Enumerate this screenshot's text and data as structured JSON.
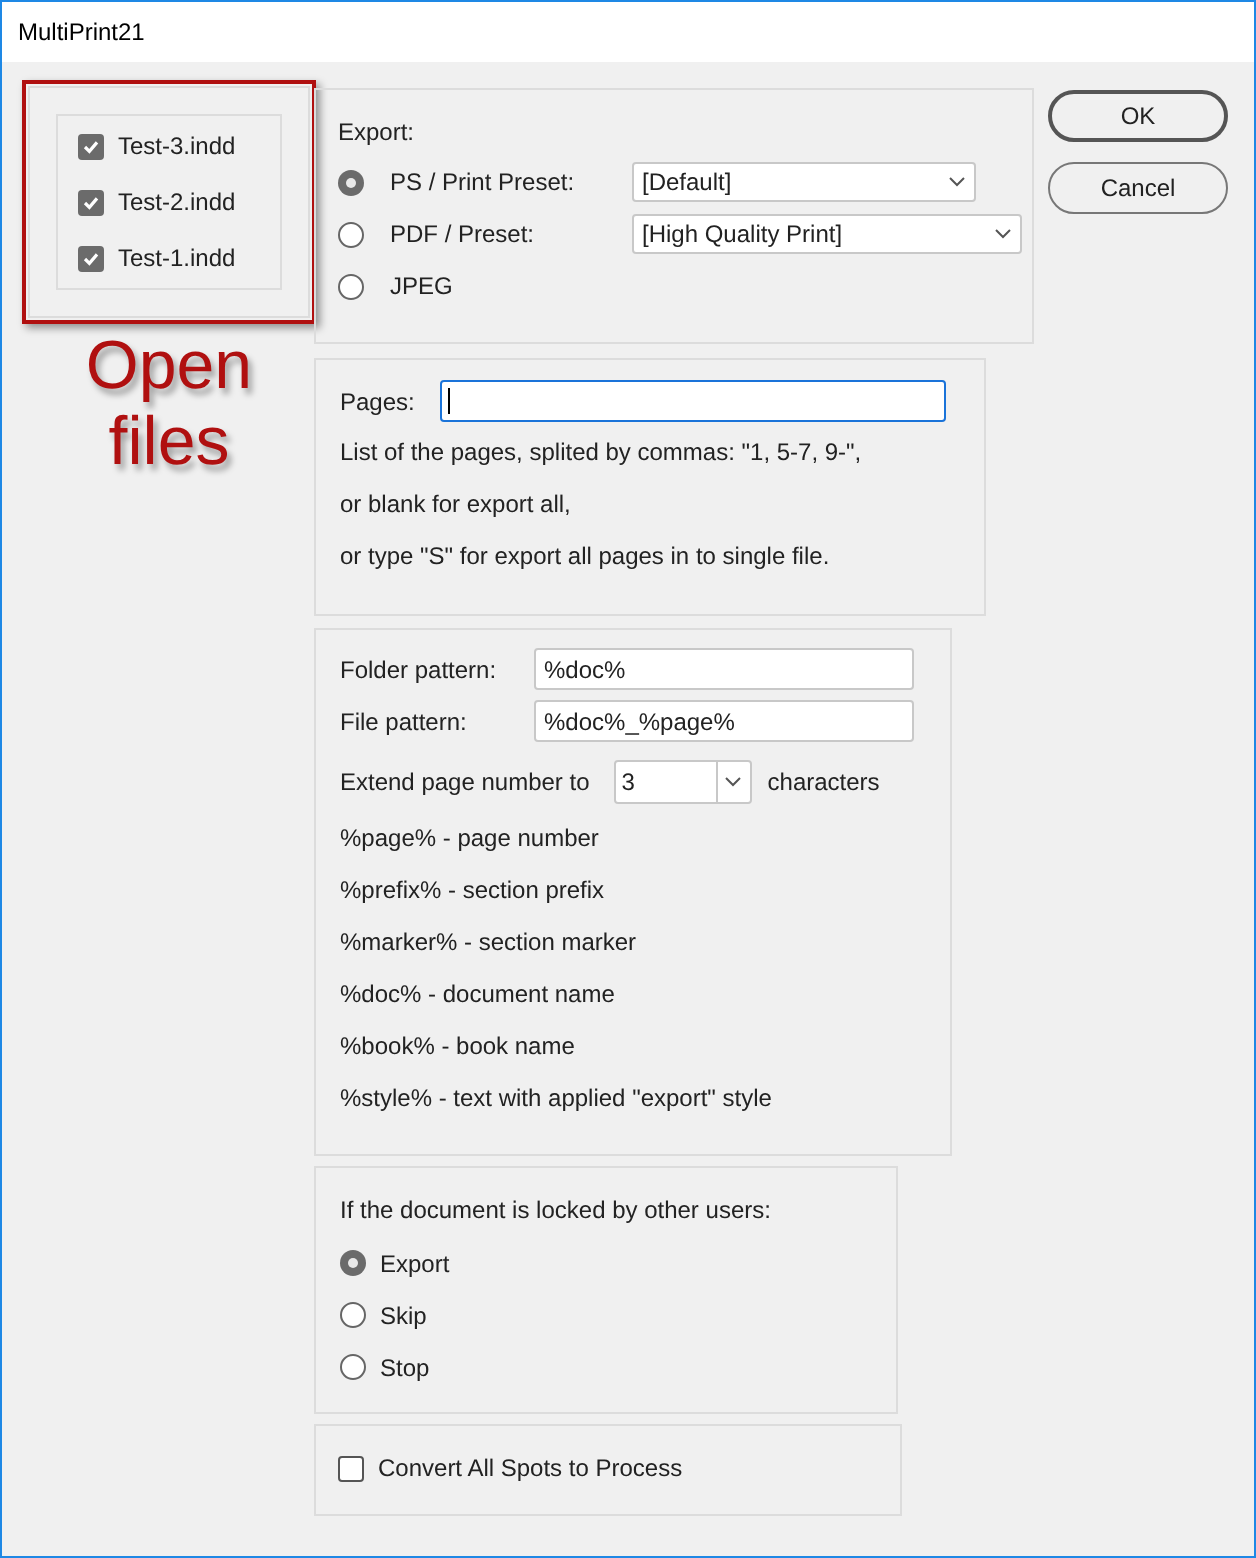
{
  "window": {
    "title": "MultiPrint21"
  },
  "files": [
    {
      "name": "Test-3.indd",
      "checked": true
    },
    {
      "name": "Test-2.indd",
      "checked": true
    },
    {
      "name": "Test-1.indd",
      "checked": true
    }
  ],
  "annotation": {
    "text": "Open files"
  },
  "export": {
    "label": "Export:",
    "options": [
      {
        "label": "PS / Print Preset:",
        "selected": true,
        "preset": "[Default]"
      },
      {
        "label": "PDF / Preset:",
        "selected": false,
        "preset": "[High Quality Print]"
      },
      {
        "label": "JPEG",
        "selected": false
      }
    ]
  },
  "pages": {
    "label": "Pages:",
    "focused": true,
    "help": [
      "List of the pages, splited by commas: \"1, 5-7, 9-\",",
      "or blank for export all,",
      "or type \"S\" for export all pages in to single file."
    ]
  },
  "patterns": {
    "folder": {
      "label": "Folder pattern:",
      "value": "%doc%"
    },
    "file": {
      "label": "File pattern:",
      "value": "%doc%_%page%"
    },
    "extend": {
      "label": "Extend page number to",
      "value": "3",
      "suffix": "characters"
    },
    "legend": [
      "%page% - page number",
      "%prefix% - section prefix",
      "%marker% - section marker",
      "%doc% - document name",
      "%book% - book name",
      "%style% - text with applied \"export\" style"
    ]
  },
  "locked": {
    "label": "If the document is locked by other users:",
    "options": [
      {
        "label": "Export",
        "selected": true
      },
      {
        "label": "Skip",
        "selected": false
      },
      {
        "label": "Stop",
        "selected": false
      }
    ]
  },
  "convert": {
    "label": "Convert All Spots to Process",
    "checked": false
  },
  "buttons": [
    {
      "label": "OK",
      "default": true
    },
    {
      "label": "Cancel",
      "default": false
    }
  ]
}
